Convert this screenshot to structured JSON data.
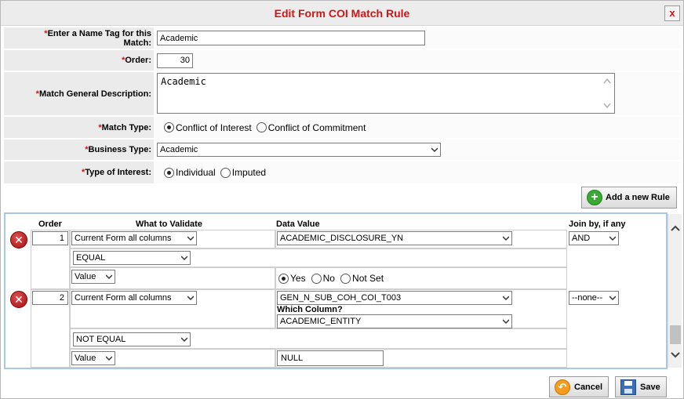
{
  "dialog": {
    "title": "Edit Form COI Match Rule",
    "close_label": "x"
  },
  "form": {
    "name_tag": {
      "label": "Enter a Name Tag for this Match:",
      "value": "Academic"
    },
    "order": {
      "label": "Order:",
      "value": "30"
    },
    "description": {
      "label": "Match General Description:",
      "value": "Academic"
    },
    "match_type": {
      "label": "Match Type:",
      "option1": "Conflict of Interest",
      "option2": "Conflict of Commitment",
      "selected": "Conflict of Interest"
    },
    "business_type": {
      "label": "Business Type:",
      "value": "Academic"
    },
    "type_of_interest": {
      "label": "Type of Interest:",
      "option1": "Individual",
      "option2": "Imputed",
      "selected": "Individual"
    },
    "required_marker": "*"
  },
  "add_rule_label": "Add a new Rule",
  "rules": {
    "headers": {
      "order": "Order",
      "what": "What to Validate",
      "data_value": "Data Value",
      "join": "Join by, if any"
    },
    "rule1": {
      "order": "1",
      "what": "Current Form all columns",
      "data_value": "ACADEMIC_DISCLOSURE_YN",
      "join": "AND",
      "operator": "EQUAL",
      "value_type": "Value",
      "yes": "Yes",
      "no": "No",
      "not_set": "Not Set",
      "selected": "Yes"
    },
    "rule2": {
      "order": "2",
      "what": "Current Form all columns",
      "data_value": "GEN_N_SUB_COH_COI_T003",
      "which_column_label": "Which Column?",
      "which_column": "ACADEMIC_ENTITY",
      "join": "--none--",
      "operator": "NOT EQUAL",
      "value_type": "Value",
      "value": "NULL"
    }
  },
  "footer": {
    "cancel": "Cancel",
    "save": "Save"
  },
  "colors": {
    "title": "#d21414",
    "required": "#d21414",
    "panel_border": "#a9c7e6",
    "add_icon": "#3aaa35",
    "delete_icon": "#c01818"
  }
}
